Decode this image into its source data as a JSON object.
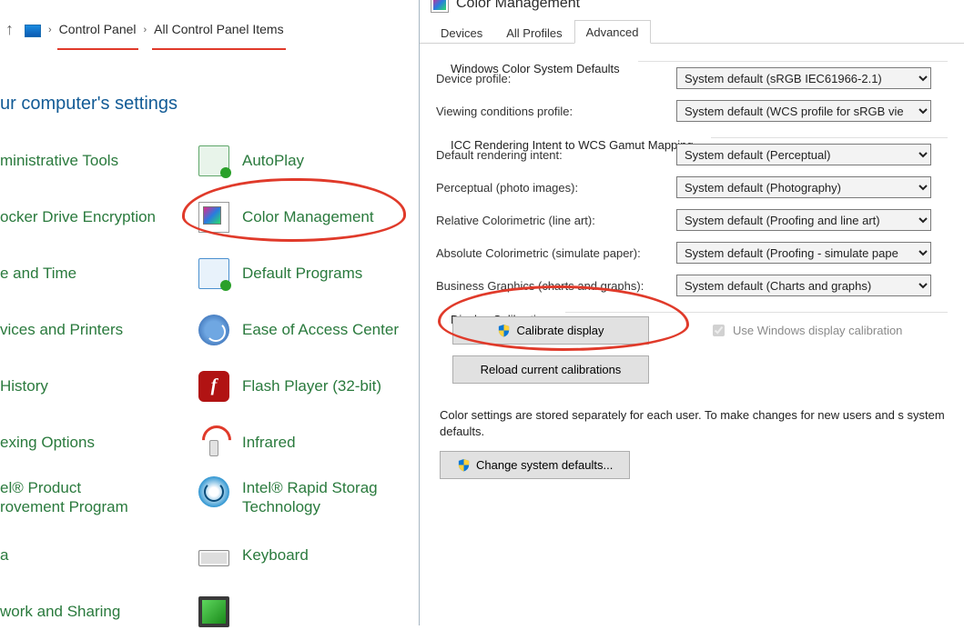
{
  "breadcrumb": {
    "item1": "Control Panel",
    "item2": "All Control Panel Items"
  },
  "heading": "ur computer's settings",
  "cp_items": {
    "c0r0": "ministrative Tools",
    "c1r0": "AutoPlay",
    "c0r1": "ocker Drive Encryption",
    "c1r1": "Color Management",
    "c0r2": "e and Time",
    "c1r2": "Default Programs",
    "c0r3": "vices and Printers",
    "c1r3": "Ease of Access Center",
    "c0r4": "History",
    "c1r4": "Flash Player (32-bit)",
    "c0r5": "exing Options",
    "c1r5": "Infrared",
    "c0r6a": "el® Product",
    "c0r6b": "rovement Program",
    "c1r6a": "Intel® Rapid Storag",
    "c1r6b": "Technology",
    "c0r7": "a",
    "c1r7": "Keyboard",
    "c0r8": "work and Sharing"
  },
  "right": {
    "title": "Color Management",
    "tabs": {
      "devices": "Devices",
      "all": "All Profiles",
      "adv": "Advanced"
    },
    "group1_title": "Windows Color System Defaults",
    "device_profile": {
      "label": "Device profile:",
      "value": "System default (sRGB IEC61966-2.1)"
    },
    "viewing_cond": {
      "label": "Viewing conditions profile:",
      "value": "System default (WCS profile for sRGB vie"
    },
    "group2_title": "ICC Rendering Intent to WCS Gamut Mapping",
    "rendering": {
      "label": "Default rendering intent:",
      "value": "System default (Perceptual)"
    },
    "perceptual": {
      "label": "Perceptual (photo images):",
      "value": "System default (Photography)"
    },
    "relcol": {
      "label": "Relative Colorimetric (line art):",
      "value": "System default (Proofing and line art)"
    },
    "abscol": {
      "label": "Absolute Colorimetric (simulate paper):",
      "value": "System default (Proofing - simulate pape"
    },
    "bizgfx": {
      "label": "Business Graphics (charts and graphs):",
      "value": "System default (Charts and graphs)"
    },
    "group3_title": "Display Calibration",
    "btn_calibrate": "Calibrate display",
    "btn_reload": "Reload current calibrations",
    "chk_label": "Use Windows display calibration",
    "desc": "Color settings are stored separately for each user. To make changes for new users and s system defaults.",
    "btn_change": "Change system defaults..."
  }
}
